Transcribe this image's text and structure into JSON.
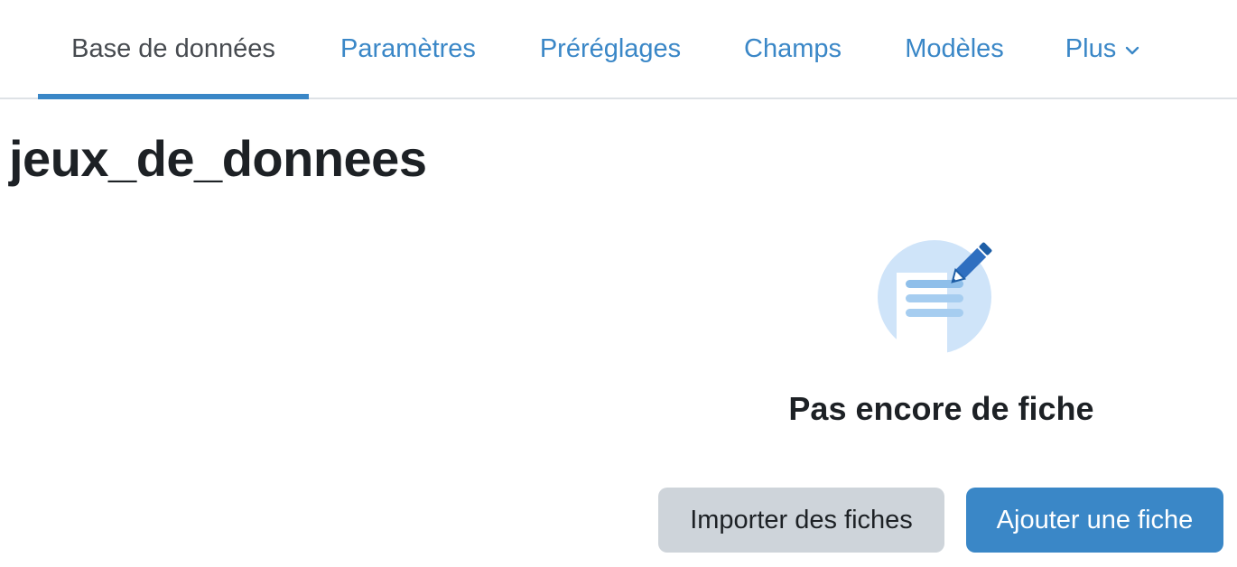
{
  "tabs": {
    "database": "Base de données",
    "settings": "Paramètres",
    "presets": "Préréglages",
    "fields": "Champs",
    "templates": "Modèles",
    "more": "Plus"
  },
  "page": {
    "title": "jeux_de_donnees"
  },
  "empty_state": {
    "message": "Pas encore de fiche",
    "icon": "note-edit-icon"
  },
  "actions": {
    "import_label": "Importer des fiches",
    "add_label": "Ajouter une fiche"
  },
  "colors": {
    "link": "#3a87c7",
    "active_tab_text": "#474b50",
    "primary_button": "#3a87c7",
    "secondary_button": "#ced4da",
    "text": "#1d2125"
  }
}
